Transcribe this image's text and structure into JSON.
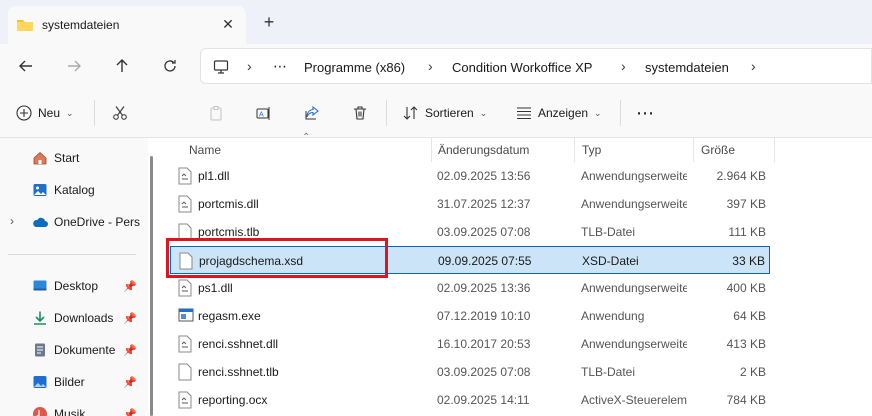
{
  "tab": {
    "title": "systemdateien",
    "close": "✕",
    "new": "+"
  },
  "nav": {
    "breadcrumb": [
      "Programme (x86)",
      "Condition Workoffice XP",
      "systemdateien"
    ],
    "more": "⋯"
  },
  "toolbar": {
    "new_label": "Neu",
    "sort_label": "Sortieren",
    "view_label": "Anzeigen",
    "more": "⋯"
  },
  "sidebar": {
    "items": [
      {
        "label": "Start",
        "icon": "home-icon"
      },
      {
        "label": "Katalog",
        "icon": "gallery-icon"
      },
      {
        "label": "OneDrive - Perso",
        "icon": "cloud-icon"
      },
      {
        "label": "Desktop",
        "icon": "desktop-icon",
        "pinned": true
      },
      {
        "label": "Downloads",
        "icon": "download-icon",
        "pinned": true
      },
      {
        "label": "Dokumente",
        "icon": "documents-icon",
        "pinned": true
      },
      {
        "label": "Bilder",
        "icon": "pictures-icon",
        "pinned": true
      },
      {
        "label": "Musik",
        "icon": "music-icon",
        "pinned": true
      }
    ]
  },
  "columns": {
    "name": "Name",
    "date": "Änderungsdatum",
    "type": "Typ",
    "size": "Größe"
  },
  "files": [
    {
      "name": "pl1.dll",
      "date": "02.09.2025 13:56",
      "type": "Anwendungserweiterung",
      "size": "2.964 KB",
      "icon": "dll-icon"
    },
    {
      "name": "portcmis.dll",
      "date": "31.07.2025 12:37",
      "type": "Anwendungserweiterung",
      "size": "397 KB",
      "icon": "dll-icon"
    },
    {
      "name": "portcmis.tlb",
      "date": "03.09.2025 07:08",
      "type": "TLB-Datei",
      "size": "111 KB",
      "icon": "file-icon"
    },
    {
      "name": "projagdschema.xsd",
      "date": "09.09.2025 07:55",
      "type": "XSD-Datei",
      "size": "33 KB",
      "icon": "file-icon",
      "selected": true
    },
    {
      "name": "ps1.dll",
      "date": "02.09.2025 13:36",
      "type": "Anwendungserweiterung",
      "size": "400 KB",
      "icon": "dll-icon"
    },
    {
      "name": "regasm.exe",
      "date": "07.12.2019 10:10",
      "type": "Anwendung",
      "size": "64 KB",
      "icon": "exe-icon"
    },
    {
      "name": "renci.sshnet.dll",
      "date": "16.10.2017 20:53",
      "type": "Anwendungserweiterung",
      "size": "413 KB",
      "icon": "dll-icon"
    },
    {
      "name": "renci.sshnet.tlb",
      "date": "03.09.2025 07:08",
      "type": "TLB-Datei",
      "size": "2 KB",
      "icon": "file-icon"
    },
    {
      "name": "reporting.ocx",
      "date": "02.09.2025 14:11",
      "type": "ActiveX-Steuerelement",
      "size": "784 KB",
      "icon": "dll-icon"
    }
  ],
  "colors": {
    "selection_bg": "#cce4f7",
    "selection_border": "#0067c0",
    "highlight": "#e0141e",
    "folder": "#f4c430"
  }
}
